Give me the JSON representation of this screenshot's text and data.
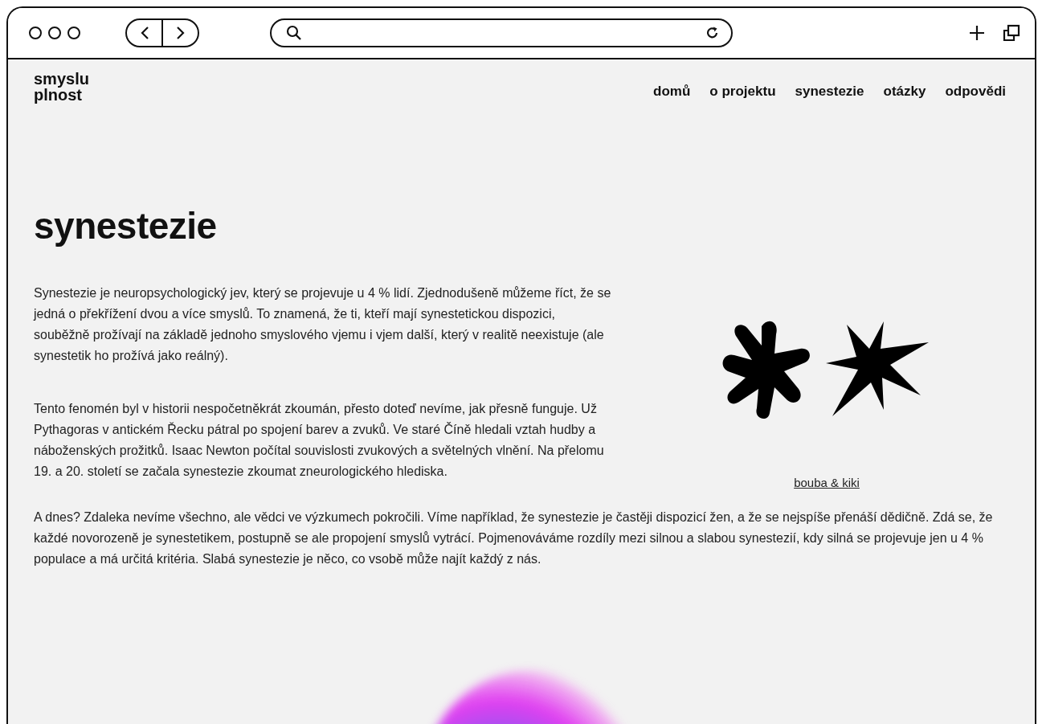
{
  "logo": [
    "smyslu",
    "plnost"
  ],
  "nav": [
    "domů",
    "o projektu",
    "synestezie",
    "otázky",
    "odpovědi"
  ],
  "heading": "synestezie",
  "intro_paragraphs": [
    "Synestezie je neuropsychologický jev, který se projevuje u 4 % lidí. Zjednodušeně můžeme říct, že se jedná o překřížení dvou a více smyslů. To znamená, že ti, kteří mají synestetickou dispozici, souběžně prožívají na základě jednoho smyslového vjemu i vjem další, který v realitě neexistuje (ale synestetik ho prožívá jako reálný).",
    "Tento fenomén byl v historii nespočetněkrát zkoumán, přesto doteď nevíme, jak přesně funguje. Už Pythagoras v antickém Řecku pátral po spojení barev a zvuků. Ve staré Číně hledali vztah hudby a náboženských prožitků. Isaac Newton počítal souvislosti zvukových a světelných vlnění. Na přelomu 19. a 20. století se začala synestezie zkoumat zneurologického hlediska."
  ],
  "figure_link": "bouba & kiki",
  "closing_paragraph": "A dnes? Zdaleka nevíme všechno, ale vědci ve výzkumech pokročili. Víme například, že synestezie je častěji dispozicí žen, a že se nejspíše přenáší dědičně. Zdá se, že každé novorozeně je synestetikem, postupně se ale propojení smyslů vytrácí. Pojmenováváme rozdíly mezi silnou a slabou synestezií, kdy silná se projevuje jen u 4 % populace a má určitá kritéria. Slabá synestezie je něco, co vsobě může najít každý z nás."
}
